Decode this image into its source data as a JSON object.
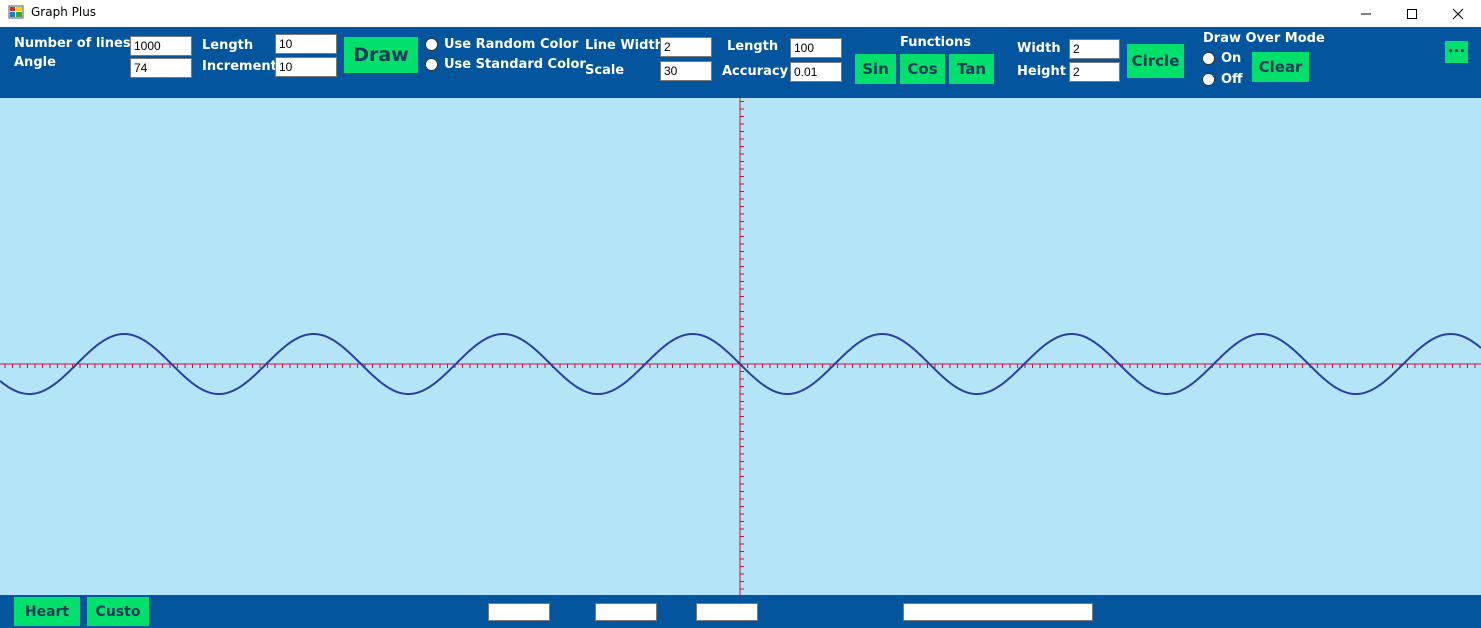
{
  "window": {
    "title": "Graph Plus"
  },
  "toolbar": {
    "lines_label": "Number of lines",
    "lines_value": "1000",
    "angle_label": "Angle",
    "angle_value": "74",
    "length_label": "Length",
    "length_value": "10",
    "increment_label": "Increment",
    "increment_value": "10",
    "draw_label": "Draw",
    "random_color_label": "Use Random Color",
    "standard_color_label": "Use Standard Color",
    "line_width_label": "Line Width",
    "line_width_value": "2",
    "scale_label": "Scale",
    "scale_value": "30",
    "length2_label": "Length",
    "length2_value": "100",
    "accuracy_label": "Accuracy",
    "accuracy_value": "0.01",
    "functions_label": "Functions",
    "sin_label": "Sin",
    "cos_label": "Cos",
    "tan_label": "Tan",
    "width_label": "Width",
    "width_value": "2",
    "height_label": "Height",
    "height_value": "2",
    "circle_label": "Circle",
    "draw_over_label": "Draw Over Mode",
    "on_label": "On",
    "off_label": "Off",
    "clear_label": "Clear",
    "more_label": "•••"
  },
  "bottom": {
    "heart_label": "Heart",
    "custom_label": "Custo"
  },
  "colors": {
    "bar": "#03569d",
    "button": "#00e06a",
    "canvas": "#b3e5f7",
    "axis": "#d0103a",
    "curve": "#2c3fa0"
  }
}
